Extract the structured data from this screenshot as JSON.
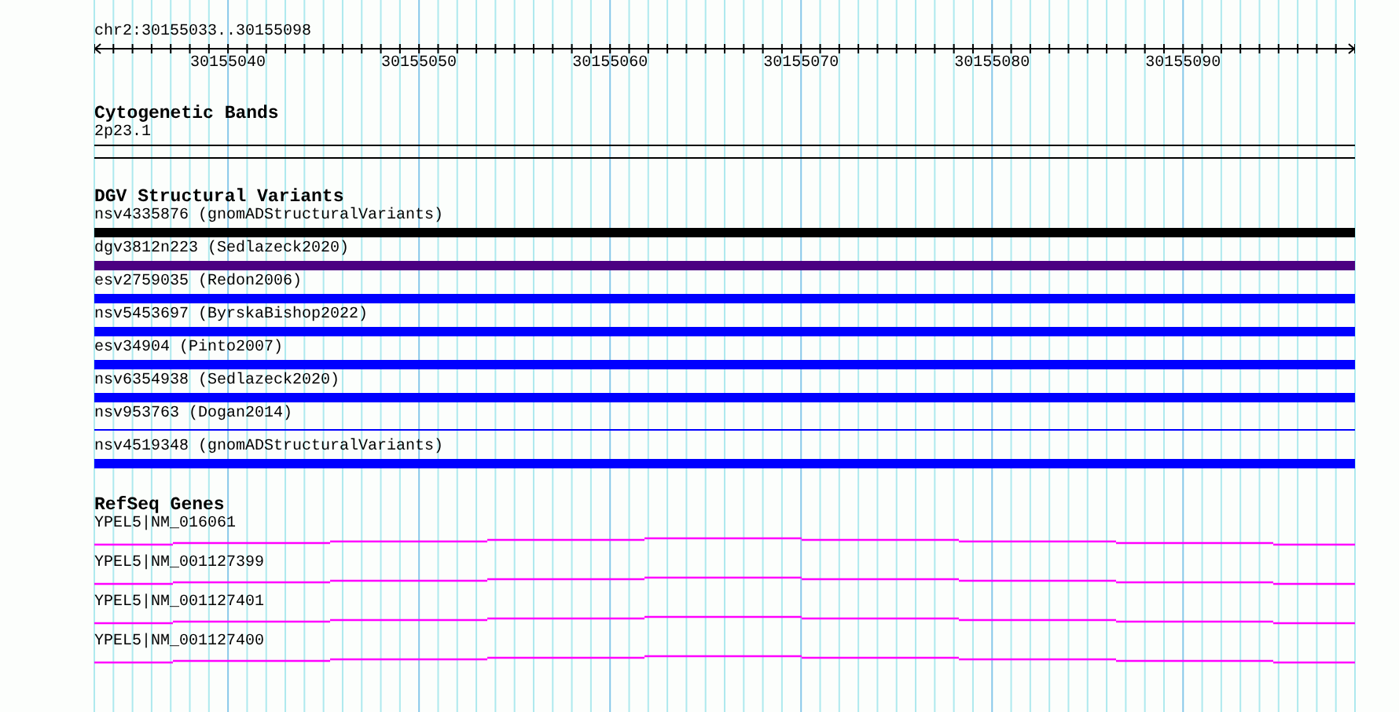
{
  "region": "chr2:30155033..30155098",
  "ruler": {
    "labels": [
      "30155040",
      "30155050",
      "30155060",
      "30155070",
      "30155080",
      "30155090"
    ]
  },
  "cytogenetic_bands": {
    "title": "Cytogenetic Bands",
    "band": "2p23.1"
  },
  "dgv_structural_variants": {
    "title": "DGV Structural Variants",
    "variants": [
      {
        "label": "nsv4335876 (gnomADStructuralVariants)",
        "color": "#000000",
        "kind": "bar"
      },
      {
        "label": "dgv3812n223 (Sedlazeck2020)",
        "color": "#4b0082",
        "kind": "bar"
      },
      {
        "label": "esv2759035 (Redon2006)",
        "color": "#0000ff",
        "kind": "bar"
      },
      {
        "label": "nsv5453697 (ByrskaBishop2022)",
        "color": "#0000ff",
        "kind": "bar"
      },
      {
        "label": "esv34904 (Pinto2007)",
        "color": "#0000ff",
        "kind": "bar"
      },
      {
        "label": "nsv6354938 (Sedlazeck2020)",
        "color": "#0000ff",
        "kind": "bar"
      },
      {
        "label": "nsv953763 (Dogan2014)",
        "color": "#0000ff",
        "kind": "line"
      },
      {
        "label": "nsv4519348 (gnomADStructuralVariants)",
        "color": "#0000ff",
        "kind": "bar"
      }
    ]
  },
  "refseq_genes": {
    "title": "RefSeq Genes",
    "genes": [
      {
        "label": "YPEL5|NM_016061"
      },
      {
        "label": "YPEL5|NM_001127399"
      },
      {
        "label": "YPEL5|NM_001127401"
      },
      {
        "label": "YPEL5|NM_001127400"
      }
    ]
  }
}
